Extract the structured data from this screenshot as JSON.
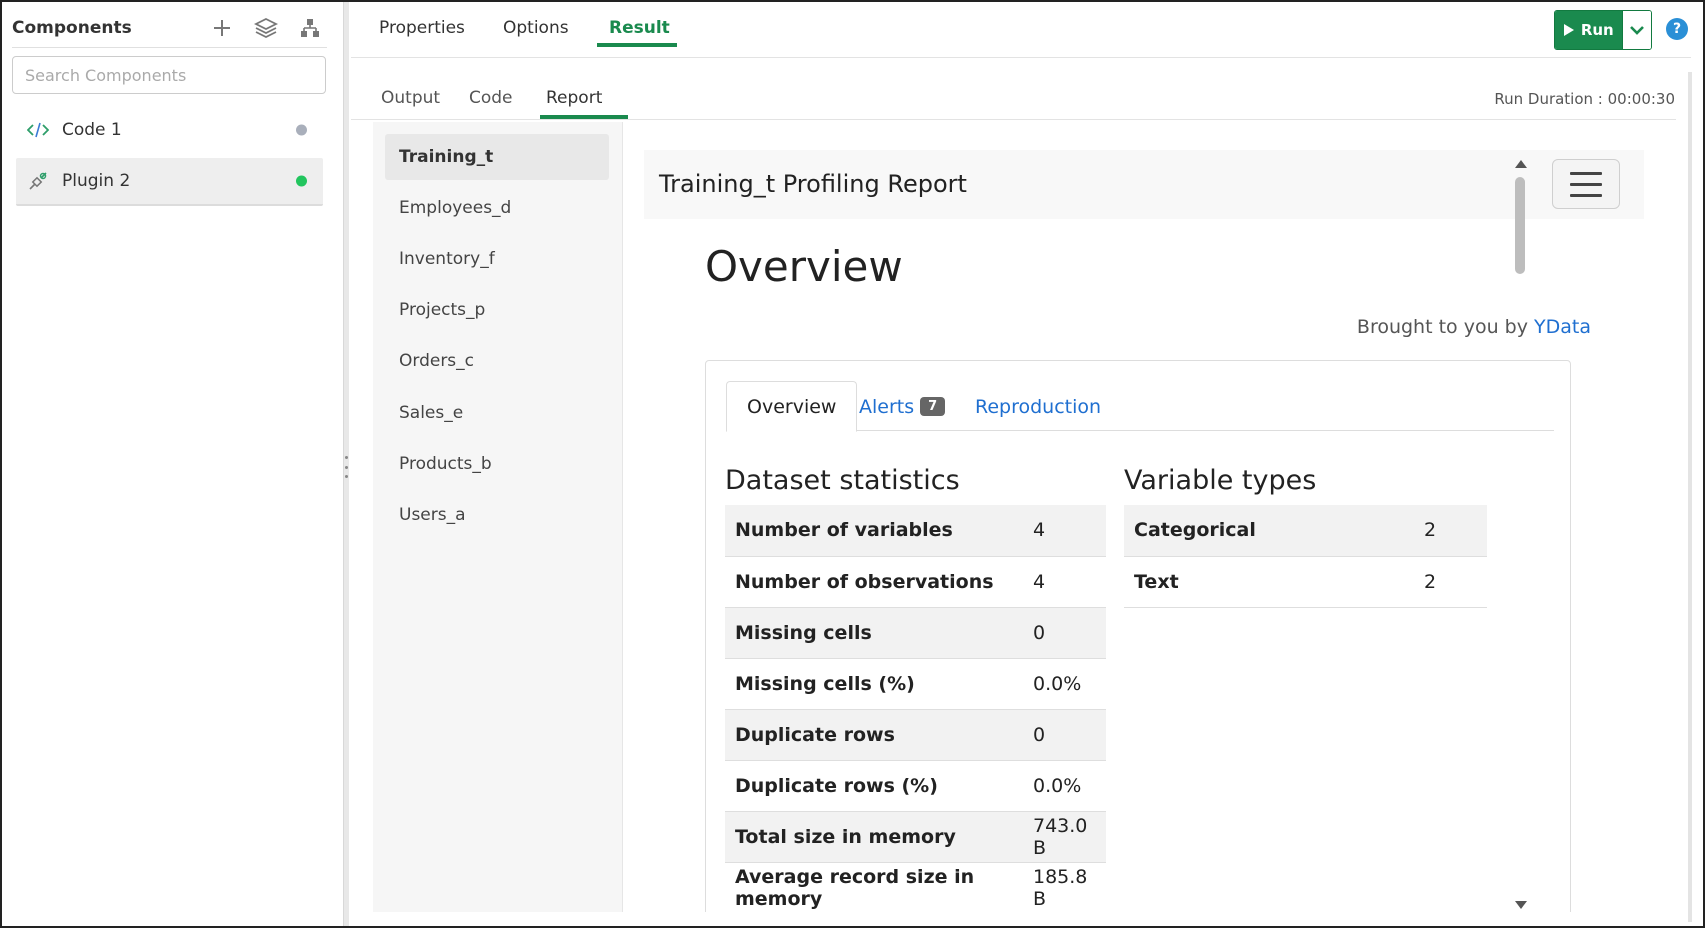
{
  "sidebar": {
    "title": "Components",
    "search_placeholder": "Search Components",
    "items": [
      {
        "label": "Code 1",
        "status_color": "#a9afbb"
      },
      {
        "label": "Plugin 2",
        "status_color": "#22c55e"
      }
    ]
  },
  "top_tabs": [
    "Properties",
    "Options",
    "Result"
  ],
  "run": {
    "label": "Run",
    "help": "?"
  },
  "sub_tabs": [
    "Output",
    "Code",
    "Report"
  ],
  "run_duration": "Run Duration : 00:00:30",
  "datasets": [
    "Training_t",
    "Employees_d",
    "Inventory_f",
    "Projects_p",
    "Orders_c",
    "Sales_e",
    "Products_b",
    "Users_a"
  ],
  "report": {
    "title": "Training_t Profiling Report",
    "heading": "Overview",
    "brought_prefix": "Brought to you by",
    "brought_link": "YData",
    "tabs": {
      "overview": "Overview",
      "alerts": "Alerts",
      "alerts_count": "7",
      "reproduction": "Reproduction"
    },
    "dataset_statistics": {
      "title": "Dataset statistics",
      "rows": [
        {
          "label": "Number of variables",
          "value": "4"
        },
        {
          "label": "Number of observations",
          "value": "4"
        },
        {
          "label": "Missing cells",
          "value": "0"
        },
        {
          "label": "Missing cells (%)",
          "value": "0.0%"
        },
        {
          "label": "Duplicate rows",
          "value": "0"
        },
        {
          "label": "Duplicate rows (%)",
          "value": "0.0%"
        },
        {
          "label": "Total size in memory",
          "value": "743.0 B"
        },
        {
          "label": "Average record size in memory",
          "value": "185.8 B"
        }
      ]
    },
    "variable_types": {
      "title": "Variable types",
      "rows": [
        {
          "label": "Categorical",
          "value": "2"
        },
        {
          "label": "Text",
          "value": "2"
        }
      ]
    }
  },
  "colors": {
    "accent": "#1a8a4e",
    "link": "#1f6fd0",
    "help": "#2a8fd6"
  }
}
